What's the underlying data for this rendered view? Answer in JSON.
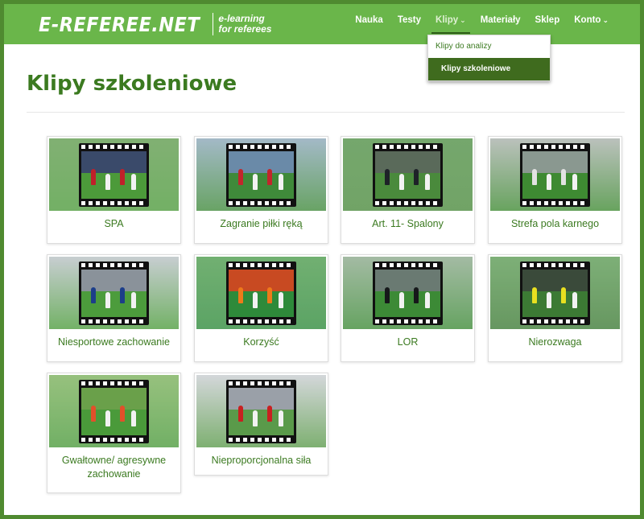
{
  "header": {
    "logo_text": "E-REFEREE.NET",
    "logo_tagline_1": "e-learning",
    "logo_tagline_2": "for referees",
    "nav": [
      {
        "label": "Nauka",
        "dropdown": false
      },
      {
        "label": "Testy",
        "dropdown": false
      },
      {
        "label": "Klipy",
        "dropdown": true,
        "active": true
      },
      {
        "label": "Materiały",
        "dropdown": false
      },
      {
        "label": "Sklep",
        "dropdown": false
      },
      {
        "label": "Konto",
        "dropdown": true
      }
    ],
    "klipy_menu": [
      {
        "label": "Klipy do analizy",
        "selected": false
      },
      {
        "label": "Klipy szkoleniowe",
        "selected": true
      }
    ]
  },
  "page": {
    "title": "Klipy szkoleniowe"
  },
  "clips": [
    {
      "label": "SPA",
      "icon": "film-strip-icon",
      "bg": "#5e9a4c",
      "sky": "#3a4a6a",
      "grass": "#4c9a3a",
      "kit": "#c0202a"
    },
    {
      "label": "Zagranie piłki ręką",
      "icon": "film-strip-icon",
      "bg": "#8aa6b8",
      "sky": "#6a8aa8",
      "grass": "#3f8a3a",
      "kit": "#c2262c"
    },
    {
      "label": "Art. 11- Spalony",
      "icon": "film-strip-icon",
      "bg": "#4f8f44",
      "sky": "#5a6a5a",
      "grass": "#4a8a3c",
      "kit": "#1e2228"
    },
    {
      "label": "Strefa pola karnego",
      "icon": "film-strip-icon",
      "bg": "#a8b0aa",
      "sky": "#8a9890",
      "grass": "#3e8a32",
      "kit": "#e2e2e2"
    },
    {
      "label": "Niesportowe zachowanie",
      "icon": "film-strip-icon",
      "bg": "#b8c0c4",
      "sky": "#8a929a",
      "grass": "#4c9c3c",
      "kit": "#1c3e8a"
    },
    {
      "label": "Korzyść",
      "icon": "film-strip-icon",
      "bg": "#4a9a4a",
      "sky": "#c84a22",
      "grass": "#2e8a3a",
      "kit": "#ee7a1a"
    },
    {
      "label": "LOR",
      "icon": "film-strip-icon",
      "bg": "#8aa88a",
      "sky": "#6a7a72",
      "grass": "#3c8a36",
      "kit": "#16181a"
    },
    {
      "label": "Nierozwaga",
      "icon": "film-strip-icon",
      "bg": "#5a9a52",
      "sky": "#3a4a3a",
      "grass": "#3c7a34",
      "kit": "#e8e020"
    },
    {
      "label": "Gwałtowne/ agresywne zachowanie",
      "icon": "film-strip-icon",
      "bg": "#7ab05a",
      "sky": "#6aa04a",
      "grass": "#4a9a3a",
      "kit": "#e2502a"
    },
    {
      "label": "Nieproporcjonalna siła",
      "icon": "film-strip-icon",
      "bg": "#c8ccd0",
      "sky": "#9aa0a8",
      "grass": "#5a9a4a",
      "kit": "#c82020"
    }
  ]
}
